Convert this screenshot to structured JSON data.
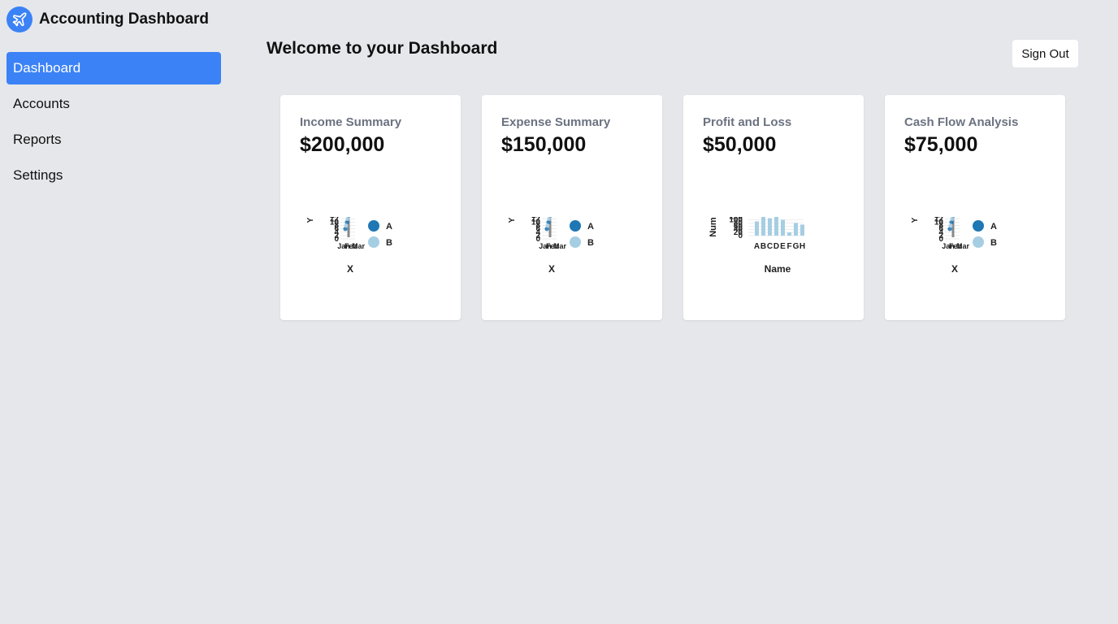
{
  "app": {
    "title": "Accounting Dashboard",
    "logo_icon": "airplane-icon",
    "accent": "#3b82f6"
  },
  "sidebar": {
    "items": [
      {
        "label": "Dashboard",
        "active": true
      },
      {
        "label": "Accounts",
        "active": false
      },
      {
        "label": "Reports",
        "active": false
      },
      {
        "label": "Settings",
        "active": false
      }
    ]
  },
  "header": {
    "title": "Welcome to your Dashboard",
    "sign_out_label": "Sign Out"
  },
  "cards": [
    {
      "title": "Income Summary",
      "value": "$200,000"
    },
    {
      "title": "Expense Summary",
      "value": "$150,000"
    },
    {
      "title": "Profit and Loss",
      "value": "$50,000"
    },
    {
      "title": "Cash Flow Analysis",
      "value": "$75,000"
    }
  ],
  "chart_data": [
    {
      "type": "scatter",
      "xlabel": "X",
      "ylabel": "Y",
      "legend": [
        "A",
        "B"
      ],
      "legend_colors": [
        "#1f77b4",
        "#a6cee3"
      ],
      "legend_position": "right",
      "yticks": [
        "16",
        "14",
        "12",
        "10",
        "8",
        "6",
        "4",
        "2",
        "0"
      ],
      "xticks": [
        "Jan",
        "Feb",
        "Mar"
      ],
      "series": [
        {
          "name": "A",
          "values": [
            4,
            8,
            12
          ]
        },
        {
          "name": "B",
          "values": [
            6,
            10,
            14
          ]
        }
      ]
    },
    {
      "type": "scatter",
      "xlabel": "X",
      "ylabel": "Y",
      "legend": [
        "A",
        "B"
      ],
      "legend_colors": [
        "#1f77b4",
        "#a6cee3"
      ],
      "legend_position": "right",
      "yticks": [
        "16",
        "14",
        "12",
        "10",
        "8",
        "6",
        "4",
        "2",
        "0"
      ],
      "xticks": [
        "Jan",
        "Feb",
        "Mar"
      ],
      "series": [
        {
          "name": "A",
          "values": [
            4,
            8,
            12
          ]
        },
        {
          "name": "B",
          "values": [
            6,
            10,
            14
          ]
        }
      ]
    },
    {
      "type": "bar",
      "xlabel": "Name",
      "ylabel": "Number",
      "categories": [
        "A",
        "B",
        "C",
        "D",
        "E",
        "F",
        "G",
        "H"
      ],
      "values": [
        90,
        120,
        110,
        140,
        100,
        20,
        80,
        70
      ],
      "ylim": [
        0,
        180
      ],
      "yticks": [
        "180",
        "160",
        "140",
        "120",
        "100",
        "80",
        "60",
        "40",
        "20",
        "0"
      ],
      "bar_color": "#a6cee3"
    },
    {
      "type": "scatter",
      "xlabel": "X",
      "ylabel": "Y",
      "legend": [
        "A",
        "B"
      ],
      "legend_colors": [
        "#1f77b4",
        "#a6cee3"
      ],
      "legend_position": "right",
      "yticks": [
        "16",
        "14",
        "12",
        "10",
        "8",
        "6",
        "4",
        "2",
        "0"
      ],
      "xticks": [
        "Jan",
        "Feb",
        "Mar"
      ],
      "series": [
        {
          "name": "A",
          "values": [
            4,
            8,
            12
          ]
        },
        {
          "name": "B",
          "values": [
            6,
            10,
            14
          ]
        }
      ]
    }
  ]
}
